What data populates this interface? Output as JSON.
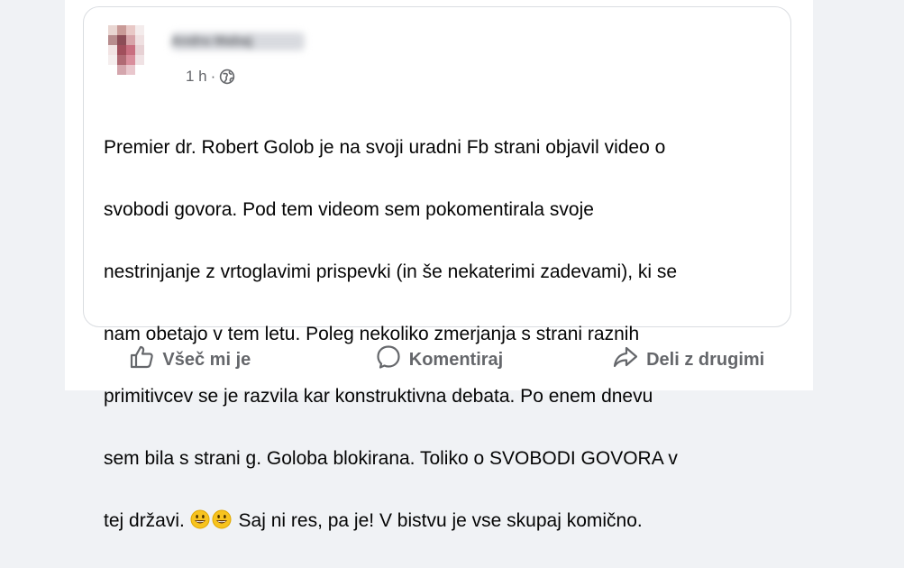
{
  "post": {
    "author_name": "Andra Mabaj",
    "time": "1 h",
    "separator": "·",
    "privacy_icon": "globe-icon",
    "text_lines": [
      "Premier dr. Robert Golob je na svoji uradni Fb strani objavil video o",
      "svobodi govora. Pod tem videom sem pokomentirala svoje",
      "nestrinjanje z vrtoglavimi prispevki (in še nekaterimi zadevami), ki se",
      "nam obetajo v tem letu. Poleg nekoliko zmerjanja s strani raznih",
      "primitivcev se je razvila kar konstruktivna debata. Po enem dnevu",
      "sem bila s strani g. Goloba blokirana. Toliko o SVOBODI GOVORA v"
    ],
    "last_line_prefix": "tej državi. ",
    "last_line_suffix": " Saj ni res, pa je! V bistvu je vse skupaj komično.",
    "emoji": "grinning-face-emoji"
  },
  "actions": {
    "like_label": "Všeč mi je",
    "comment_label": "Komentiraj",
    "share_label": "Deli z drugimi"
  },
  "colors": {
    "background": "#f0f2f5",
    "card": "#ffffff",
    "secondary_text": "#65676b",
    "primary_text": "#050505",
    "border": "#dadde1"
  }
}
